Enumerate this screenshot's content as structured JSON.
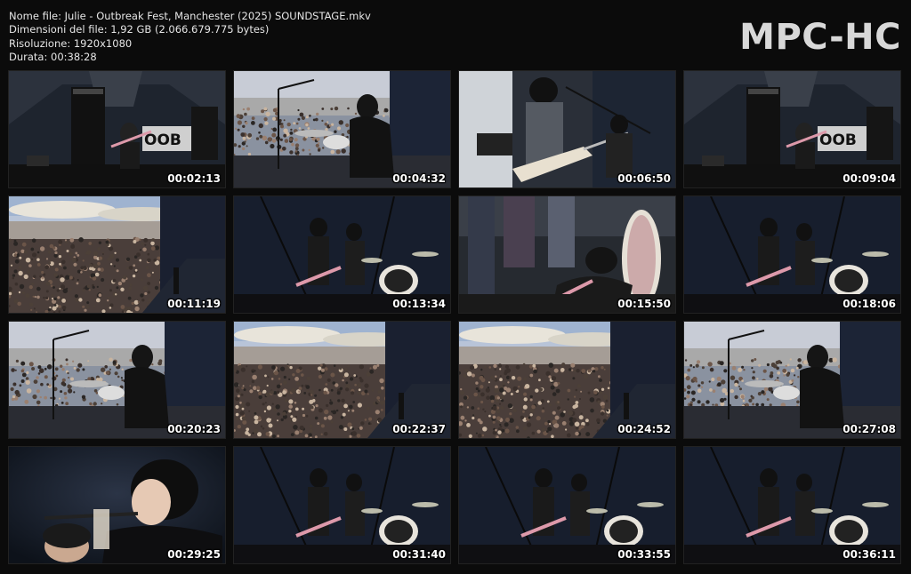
{
  "file_info": {
    "name_line": "Nome file: Julie - Outbreak Fest, Manchester (2025) SOUNDSTAGE.mkv",
    "size_line": "Dimensioni del file: 1,92 GB (2.066.679.775 bytes)",
    "resolution_line": "Risoluzione: 1920x1080",
    "duration_line": "Durata: 00:38:28"
  },
  "logo": {
    "text": "MPC-HC"
  },
  "thumbnails": [
    {
      "time": "00:02:13",
      "scene": "stage-wide"
    },
    {
      "time": "00:04:32",
      "scene": "crowd-drummer"
    },
    {
      "time": "00:06:50",
      "scene": "guitarist-close"
    },
    {
      "time": "00:09:04",
      "scene": "stage-wide"
    },
    {
      "time": "00:11:19",
      "scene": "crowd-sky"
    },
    {
      "time": "00:13:34",
      "scene": "band-stage-dark"
    },
    {
      "time": "00:15:50",
      "scene": "guitarist-kneel"
    },
    {
      "time": "00:18:06",
      "scene": "band-stage-dark"
    },
    {
      "time": "00:20:23",
      "scene": "crowd-drummer"
    },
    {
      "time": "00:22:37",
      "scene": "crowd-sky"
    },
    {
      "time": "00:24:52",
      "scene": "crowd-sky"
    },
    {
      "time": "00:27:08",
      "scene": "crowd-drummer"
    },
    {
      "time": "00:29:25",
      "scene": "singer-close"
    },
    {
      "time": "00:31:40",
      "scene": "band-stage-dark"
    },
    {
      "time": "00:33:55",
      "scene": "band-stage-dark"
    },
    {
      "time": "00:36:11",
      "scene": "band-stage-dark"
    }
  ],
  "colors": {
    "background": "#0b0b0b",
    "text": "#e6e6e6",
    "logo": "#d8d8d8",
    "timestamp": "#ffffff"
  }
}
